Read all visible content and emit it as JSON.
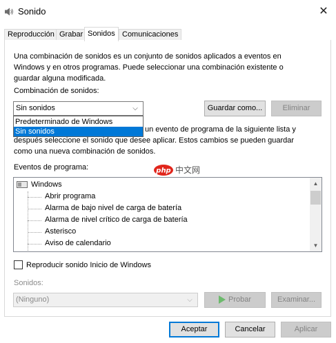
{
  "window": {
    "title": "Sonido",
    "close_glyph": "✕"
  },
  "tabs": [
    {
      "label": "Reproducción"
    },
    {
      "label": "Grabar"
    },
    {
      "label": "Sonidos"
    },
    {
      "label": "Comunicaciones"
    }
  ],
  "active_tab": "Sonidos",
  "sounds": {
    "description": "Una combinación de sonidos es un conjunto de sonidos aplicados a eventos en Windows y en otros programas. Puede seleccionar una combinación existente o guardar alguna modificada.",
    "scheme_label": "Combinación de sonidos:",
    "scheme_value": "Sin sonidos",
    "save_as_label": "Guardar como...",
    "delete_label": "Eliminar",
    "dropdown_options": [
      "Predeterminado de Windows",
      "Sin sonidos"
    ],
    "dropdown_selected": "Sin sonidos",
    "instructions_line1": "un evento de programa de la siguiente lista y",
    "instructions_line2": "después seleccione el sonido que desee aplicar. Estos cambios se pueden guardar",
    "instructions_line3": "como una nueva combinación de sonidos.",
    "events_label": "Eventos de programa:",
    "events_root": "Windows",
    "events": [
      "Abrir programa",
      "Alarma de bajo nivel de carga de batería",
      "Alarma de nivel crítico de carga de batería",
      "Asterisco",
      "Aviso de calendario"
    ],
    "startup_sound_label": "Reproducir sonido Inicio de Windows",
    "startup_sound_checked": false,
    "sounds_label": "Sonidos:",
    "sound_value": "(Ninguno)",
    "test_label": "Probar",
    "browse_label": "Examinar..."
  },
  "footer": {
    "accept_label": "Aceptar",
    "cancel_label": "Cancelar",
    "apply_label": "Aplicar"
  },
  "colors": {
    "selection": "#0078d7",
    "play_icon": "#6cba6c",
    "watermark_php": "#e1261c"
  },
  "watermark": {
    "part1": "php",
    "part2": "中文网"
  }
}
